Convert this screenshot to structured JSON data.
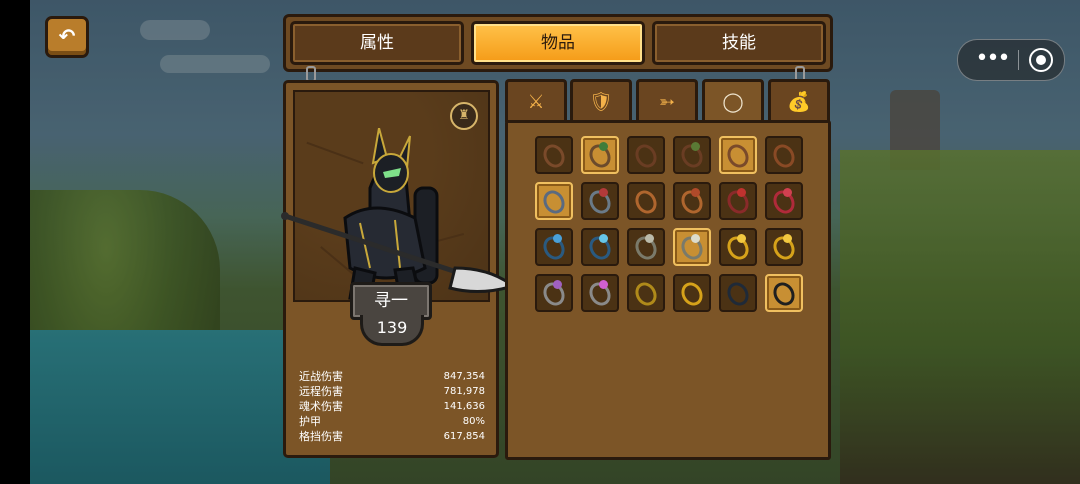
{
  "nav": {
    "back_icon": "↶"
  },
  "capsule": {
    "more_icon": "•••",
    "close_icon": "target-circle"
  },
  "main_tabs": [
    {
      "label": "属性",
      "active": false
    },
    {
      "label": "物品",
      "active": true
    },
    {
      "label": "技能",
      "active": false
    }
  ],
  "hero": {
    "name": "寻一",
    "level": "139",
    "helmet_icon": "helmet-icon",
    "stats": [
      {
        "label": "近战伤害",
        "value": "847,354"
      },
      {
        "label": "远程伤害",
        "value": "781,978"
      },
      {
        "label": "魂术伤害",
        "value": "141,636"
      },
      {
        "label": "护甲",
        "value": "80%"
      },
      {
        "label": "格挡伤害",
        "value": "617,854"
      }
    ]
  },
  "category_tabs": [
    {
      "icon": "crossed-swords-icon",
      "glyph": "⚔",
      "active": false
    },
    {
      "icon": "armor-icon",
      "glyph": "🛡",
      "active": false
    },
    {
      "icon": "bow-icon",
      "glyph": "➳",
      "active": false
    },
    {
      "icon": "ring-icon",
      "glyph": "◯",
      "active": true
    },
    {
      "icon": "bag-icon",
      "glyph": "💰",
      "active": false
    }
  ],
  "colors": {
    "panel": "#7c5527",
    "panel_dark": "#2a1a0d",
    "accent_tab": "#f59b17"
  },
  "rings": [
    [
      {
        "c": "#7a4a2a",
        "g": null,
        "s": false
      },
      {
        "c": "#6b4b2c",
        "g": "#3f7d3a",
        "s": true
      },
      {
        "c": "#6a3d23",
        "g": null,
        "s": false
      },
      {
        "c": "#6a3d23",
        "g": "#5a7a35",
        "s": false
      },
      {
        "c": "#7a4a2a",
        "g": null,
        "s": true
      },
      {
        "c": "#8a4a25",
        "g": null,
        "s": false
      }
    ],
    [
      {
        "c": "#5a6a80",
        "g": null,
        "s": true
      },
      {
        "c": "#6a7a88",
        "g": "#b23a3a",
        "s": false
      },
      {
        "c": "#b0662e",
        "g": null,
        "s": false
      },
      {
        "c": "#b0662e",
        "g": "#b04a2a",
        "s": false
      },
      {
        "c": "#8a2a2a",
        "g": "#c0322f",
        "s": false
      },
      {
        "c": "#b02a3a",
        "g": "#d04050",
        "s": false
      }
    ],
    [
      {
        "c": "#2a5a80",
        "g": "#4aa0d8",
        "s": false
      },
      {
        "c": "#2a5a80",
        "g": "#66c6e8",
        "s": false
      },
      {
        "c": "#7a7a6a",
        "g": "#bbbbaa",
        "s": false
      },
      {
        "c": "#7a7a6a",
        "g": "#dcdccc",
        "s": true
      },
      {
        "c": "#d6a21a",
        "g": "#f2c840",
        "s": false
      },
      {
        "c": "#d6a21a",
        "g": "#f2c840",
        "s": false
      }
    ],
    [
      {
        "c": "#8a8a8a",
        "g": "#a060c0",
        "s": false
      },
      {
        "c": "#8a8a8a",
        "g": "#d060d0",
        "s": false
      },
      {
        "c": "#b08a1a",
        "g": null,
        "s": false
      },
      {
        "c": "#d6a21a",
        "g": null,
        "s": false
      },
      {
        "c": "#1f2a38",
        "g": null,
        "s": false
      },
      {
        "c": "#1f1f1f",
        "g": null,
        "s": true
      }
    ]
  ]
}
